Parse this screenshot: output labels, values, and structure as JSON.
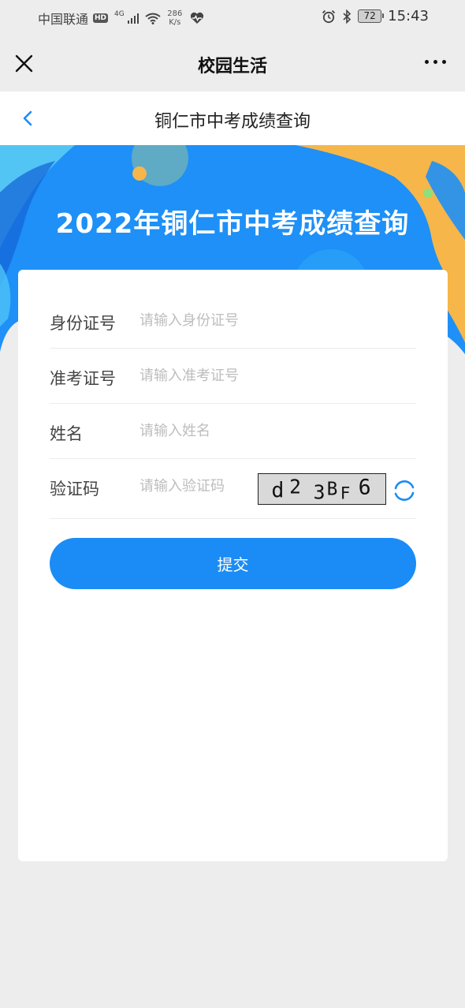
{
  "status_bar": {
    "carrier": "中国联通",
    "hd": "HD",
    "network": "4G",
    "speed_value": "286",
    "speed_unit": "K/s",
    "battery": "72",
    "time": "15:43"
  },
  "app_nav": {
    "title": "校园生活"
  },
  "page_header": {
    "title": "铜仁市中考成绩查询"
  },
  "banner": {
    "title": "2022年铜仁市中考成绩查询"
  },
  "form": {
    "id_number": {
      "label": "身份证号",
      "placeholder": "请输入身份证号",
      "value": ""
    },
    "exam_number": {
      "label": "准考证号",
      "placeholder": "请输入准考证号",
      "value": ""
    },
    "name": {
      "label": "姓名",
      "placeholder": "请输入姓名",
      "value": ""
    },
    "captcha": {
      "label": "验证码",
      "placeholder": "请输入验证码",
      "value": "",
      "image_text": "d23BF6"
    },
    "submit_label": "提交"
  },
  "colors": {
    "primary": "#1b8cf5",
    "banner_blue": "#1e90f7",
    "banner_orange": "#f6b64a",
    "page_bg": "#ededed"
  },
  "icons": {
    "close": "close-icon",
    "more": "more-icon",
    "back": "chevron-left-icon",
    "refresh": "refresh-icon"
  }
}
